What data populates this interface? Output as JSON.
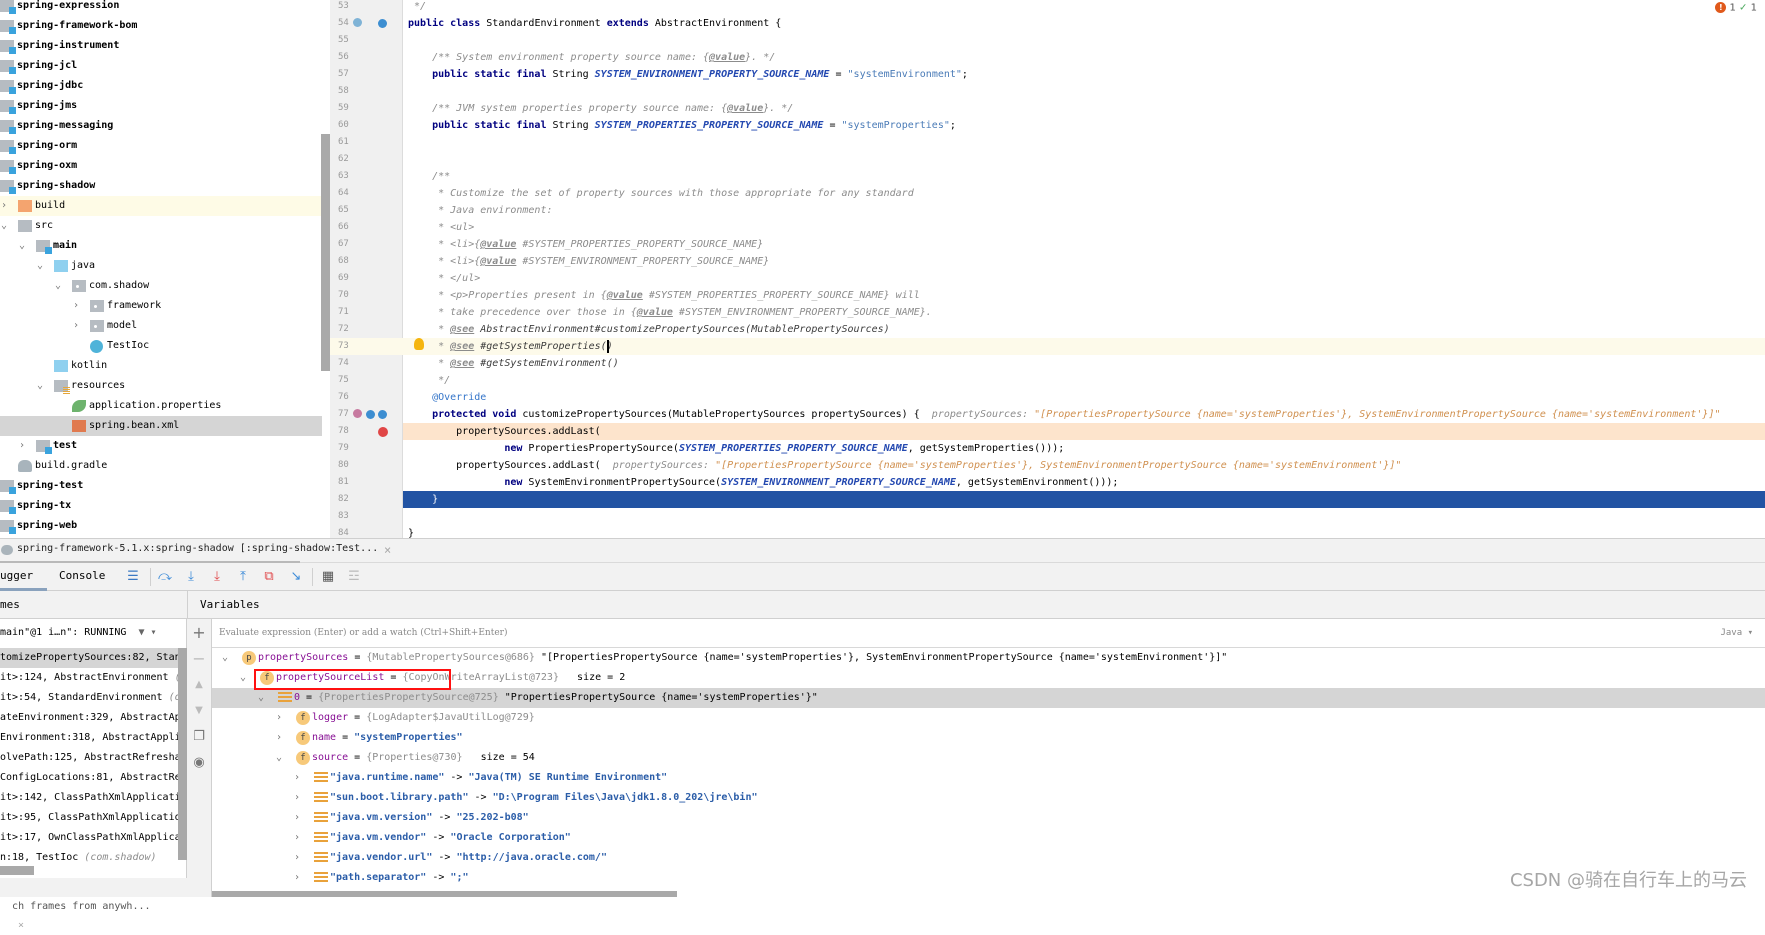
{
  "project_tree": [
    {
      "label": "spring-expression",
      "level": 0,
      "icon": "module-folder-icon",
      "bold": true
    },
    {
      "label": "spring-framework-bom",
      "level": 0,
      "icon": "module-folder-icon",
      "bold": true
    },
    {
      "label": "spring-instrument",
      "level": 0,
      "icon": "module-folder-icon",
      "bold": true
    },
    {
      "label": "spring-jcl",
      "level": 0,
      "icon": "module-folder-icon",
      "bold": true
    },
    {
      "label": "spring-jdbc",
      "level": 0,
      "icon": "module-folder-icon",
      "bold": true
    },
    {
      "label": "spring-jms",
      "level": 0,
      "icon": "module-folder-icon",
      "bold": true
    },
    {
      "label": "spring-messaging",
      "level": 0,
      "icon": "module-folder-icon",
      "bold": true
    },
    {
      "label": "spring-orm",
      "level": 0,
      "icon": "module-folder-icon",
      "bold": true
    },
    {
      "label": "spring-oxm",
      "level": 0,
      "icon": "module-folder-icon",
      "bold": true
    },
    {
      "label": "spring-shadow",
      "level": 0,
      "icon": "module-folder-icon",
      "bold": true
    },
    {
      "label": "build",
      "level": 1,
      "icon": "excluded-folder-icon",
      "chevron": "right",
      "highlight": "yellow"
    },
    {
      "label": "src",
      "level": 1,
      "icon": "folder-icon",
      "chevron": "down"
    },
    {
      "label": "main",
      "level": 2,
      "icon": "module-folder-icon",
      "chevron": "down",
      "bold": true
    },
    {
      "label": "java",
      "level": 3,
      "icon": "source-folder-icon",
      "chevron": "down"
    },
    {
      "label": "com.shadow",
      "level": 4,
      "icon": "package-icon",
      "chevron": "down"
    },
    {
      "label": "framework",
      "level": 5,
      "icon": "package-icon",
      "chevron": "right"
    },
    {
      "label": "model",
      "level": 5,
      "icon": "package-icon",
      "chevron": "right"
    },
    {
      "label": "TestIoc",
      "level": 5,
      "icon": "class-icon"
    },
    {
      "label": "kotlin",
      "level": 3,
      "icon": "source-folder-icon"
    },
    {
      "label": "resources",
      "level": 3,
      "icon": "resources-folder-icon",
      "chevron": "down"
    },
    {
      "label": "application.properties",
      "level": 4,
      "icon": "spring-properties-icon"
    },
    {
      "label": "spring.bean.xml",
      "level": 4,
      "icon": "spring-xml-icon",
      "highlight": "gray"
    },
    {
      "label": "test",
      "level": 2,
      "icon": "module-folder-icon",
      "chevron": "right",
      "bold": true
    },
    {
      "label": "build.gradle",
      "level": 1,
      "icon": "gradle-icon"
    },
    {
      "label": "spring-test",
      "level": 0,
      "icon": "module-folder-icon",
      "bold": true
    },
    {
      "label": "spring-tx",
      "level": 0,
      "icon": "module-folder-icon",
      "bold": true
    },
    {
      "label": "spring-web",
      "level": 0,
      "icon": "module-folder-icon",
      "bold": true
    }
  ],
  "editor": {
    "inspection": {
      "errors": "1",
      "ok": "1"
    },
    "lines": [
      {
        "n": "53",
        "t": [
          [
            " */",
            "cm"
          ]
        ]
      },
      {
        "n": "54",
        "t": [
          [
            "public class ",
            "kw"
          ],
          [
            "StandardEnvironment ",
            "pl"
          ],
          [
            "extends ",
            "kw"
          ],
          [
            "AbstractEnvironment {",
            "pl"
          ]
        ]
      },
      {
        "n": "55",
        "t": []
      },
      {
        "n": "56",
        "t": [
          [
            "    /** System environment property source name: {",
            "cm"
          ],
          [
            "@value",
            "tag"
          ],
          [
            "}. */",
            "cm"
          ]
        ]
      },
      {
        "n": "57",
        "t": [
          [
            "    public static final ",
            "kw"
          ],
          [
            "String ",
            "pl"
          ],
          [
            "SYSTEM_ENVIRONMENT_PROPERTY_SOURCE_NAME",
            "cst"
          ],
          [
            " = ",
            "pl"
          ],
          [
            "\"systemEnvironment\"",
            "str"
          ],
          [
            ";",
            "pl"
          ]
        ]
      },
      {
        "n": "58",
        "t": []
      },
      {
        "n": "59",
        "t": [
          [
            "    /** JVM system properties property source name: {",
            "cm"
          ],
          [
            "@value",
            "tag"
          ],
          [
            "}. */",
            "cm"
          ]
        ]
      },
      {
        "n": "60",
        "t": [
          [
            "    public static final ",
            "kw"
          ],
          [
            "String ",
            "pl"
          ],
          [
            "SYSTEM_PROPERTIES_PROPERTY_SOURCE_NAME",
            "cst"
          ],
          [
            " = ",
            "pl"
          ],
          [
            "\"systemProperties\"",
            "str"
          ],
          [
            ";",
            "pl"
          ]
        ]
      },
      {
        "n": "61",
        "t": []
      },
      {
        "n": "62",
        "t": []
      },
      {
        "n": "63",
        "t": [
          [
            "    /**",
            "cm"
          ]
        ]
      },
      {
        "n": "64",
        "t": [
          [
            "     * Customize the set of property sources with those appropriate for any standard",
            "cm"
          ]
        ]
      },
      {
        "n": "65",
        "t": [
          [
            "     * Java environment:",
            "cm"
          ]
        ]
      },
      {
        "n": "66",
        "t": [
          [
            "     * <ul>",
            "cm"
          ]
        ]
      },
      {
        "n": "67",
        "t": [
          [
            "     * <li>{",
            "cm"
          ],
          [
            "@value",
            "tag"
          ],
          [
            " #SYSTEM_PROPERTIES_PROPERTY_SOURCE_NAME}",
            "cm"
          ]
        ]
      },
      {
        "n": "68",
        "t": [
          [
            "     * <li>{",
            "cm"
          ],
          [
            "@value",
            "tag"
          ],
          [
            " #SYSTEM_ENVIRONMENT_PROPERTY_SOURCE_NAME}",
            "cm"
          ]
        ]
      },
      {
        "n": "69",
        "t": [
          [
            "     * </ul>",
            "cm"
          ]
        ]
      },
      {
        "n": "70",
        "t": [
          [
            "     * <p>Properties present in {",
            "cm"
          ],
          [
            "@value",
            "tag"
          ],
          [
            " #SYSTEM_PROPERTIES_PROPERTY_SOURCE_NAME} will",
            "cm"
          ]
        ]
      },
      {
        "n": "71",
        "t": [
          [
            "     * take precedence over those in {",
            "cm"
          ],
          [
            "@value",
            "tag"
          ],
          [
            " #SYSTEM_ENVIRONMENT_PROPERTY_SOURCE_NAME}.",
            "cm"
          ]
        ]
      },
      {
        "n": "72",
        "t": [
          [
            "     * ",
            "cm"
          ],
          [
            "@see",
            "tag"
          ],
          [
            " AbstractEnvironment#customizePropertySources(MutablePropertySources)",
            "doc"
          ]
        ]
      },
      {
        "n": "73",
        "t": [
          [
            "     * ",
            "cm"
          ],
          [
            "@see",
            "tag"
          ],
          [
            " #getSystemProperties()",
            "doc"
          ]
        ],
        "bg": "y"
      },
      {
        "n": "74",
        "t": [
          [
            "     * ",
            "cm"
          ],
          [
            "@see",
            "tag"
          ],
          [
            " #getSystemEnvironment()",
            "doc"
          ]
        ]
      },
      {
        "n": "75",
        "t": [
          [
            "     */",
            "cm"
          ]
        ]
      },
      {
        "n": "76",
        "t": [
          [
            "    @Override",
            "ann"
          ]
        ]
      },
      {
        "n": "77",
        "t": [
          [
            "    protected void ",
            "kw"
          ],
          [
            "customizePropertySources(MutablePropertySources propertySources) {  ",
            "pl"
          ],
          [
            "propertySources: ",
            "dbgn"
          ],
          [
            "\"[PropertiesPropertySource {name='systemProperties'}, SystemEnvironmentPropertySource {name='systemEnvironment'}]\"",
            "dbg"
          ]
        ]
      },
      {
        "n": "78",
        "t": [
          [
            "        propertySources.addLast(",
            "pl"
          ]
        ],
        "bg": "o"
      },
      {
        "n": "79",
        "t": [
          [
            "                new ",
            "kw"
          ],
          [
            "PropertiesPropertySource(",
            "pl"
          ],
          [
            "SYSTEM_PROPERTIES_PROPERTY_SOURCE_NAME",
            "cst"
          ],
          [
            ", getSystemProperties()));",
            "pl"
          ]
        ]
      },
      {
        "n": "80",
        "t": [
          [
            "        propertySources.addLast(  ",
            "pl"
          ],
          [
            "propertySources: ",
            "dbgn"
          ],
          [
            "\"[PropertiesPropertySource {name='systemProperties'}, SystemEnvironmentPropertySource {name='systemEnvironment'}]\"",
            "dbg"
          ]
        ]
      },
      {
        "n": "81",
        "t": [
          [
            "                new ",
            "kw"
          ],
          [
            "SystemEnvironmentPropertySource(",
            "pl"
          ],
          [
            "SYSTEM_ENVIRONMENT_PROPERTY_SOURCE_NAME",
            "cst"
          ],
          [
            ", getSystemEnvironment()));",
            "pl"
          ]
        ]
      },
      {
        "n": "82",
        "t": [
          [
            "    }",
            "pl"
          ]
        ],
        "bg": "b"
      },
      {
        "n": "83",
        "t": []
      },
      {
        "n": "84",
        "t": [
          [
            "}",
            "pl"
          ]
        ]
      }
    ]
  },
  "debug": {
    "session_title": "spring-framework-5.1.x:spring-shadow [:spring-shadow:Test...",
    "tabs": [
      {
        "label": "ugger",
        "selected": true
      },
      {
        "label": "Console",
        "selected": false
      }
    ],
    "toolbar": [
      "show-execution-point-icon",
      "step-over-icon",
      "step-into-icon",
      "force-step-into-icon",
      "step-out-icon",
      "drop-frame-icon",
      "run-to-cursor-icon",
      "evaluate-expression-icon",
      "trace-icon"
    ],
    "frames_header": "mes",
    "variables_header": "Variables",
    "thread": "main\"@1 i…n\": RUNNING",
    "frames": [
      {
        "text": "tomizePropertySources:82, Stand",
        "pkg": ""
      },
      {
        "text": "it>:124, AbstractEnvironment ",
        "pkg": "(o"
      },
      {
        "text": "it>:54, StandardEnvironment ",
        "pkg": "(or"
      },
      {
        "text": "ateEnvironment:329, AbstractApp",
        "pkg": ""
      },
      {
        "text": "Environment:318, AbstractApplic",
        "pkg": ""
      },
      {
        "text": "olvePath:125, AbstractRefreshab",
        "pkg": ""
      },
      {
        "text": "ConfigLocations:81, AbstractRef",
        "pkg": ""
      },
      {
        "text": "it>:142, ClassPathXmlApplicatio",
        "pkg": ""
      },
      {
        "text": "it>:95, ClassPathXmlApplication",
        "pkg": ""
      },
      {
        "text": "it>:17, OwnClassPathXmlApplicat",
        "pkg": ""
      },
      {
        "text": "n:18, TestIoc ",
        "pkg": "(com.shadow)"
      }
    ],
    "frames_search": "ch frames from anywh...",
    "evaluate_placeholder": "Evaluate expression (Enter) or add a watch (Ctrl+Shift+Enter)",
    "language": "Java",
    "variables": [
      {
        "level": 0,
        "chevron": "down",
        "icon": "p",
        "name": "propertySources",
        "type": "{MutablePropertySources@686}",
        "value": "\"[PropertiesPropertySource {name='systemProperties'}, SystemEnvironmentPropertySource {name='systemEnvironment'}]\"",
        "vclass": "vp"
      },
      {
        "level": 1,
        "chevron": "down",
        "icon": "f",
        "name": "propertySourceList",
        "type": "{CopyOnWriteArrayList@723}",
        "value": "  size = 2",
        "vclass": "vp",
        "boxed": true
      },
      {
        "level": 2,
        "chevron": "down",
        "icon": "list",
        "name": "0",
        "type": "{PropertiesPropertySource@725}",
        "value": "\"PropertiesPropertySource {name='systemProperties'}\"",
        "vclass": "vp",
        "selected": true
      },
      {
        "level": 3,
        "chevron": "right",
        "icon": "f",
        "name": "logger",
        "type": "{LogAdapter$JavaUtilLog@729}",
        "value": "",
        "vclass": "vp"
      },
      {
        "level": 3,
        "chevron": "right",
        "icon": "f",
        "name": "name",
        "type": "",
        "value": "\"systemProperties\"",
        "vclass": "vs"
      },
      {
        "level": 3,
        "chevron": "down",
        "icon": "f",
        "name": "source",
        "type": "{Properties@730}",
        "value": "  size = 54",
        "vclass": "vp"
      },
      {
        "level": 4,
        "chevron": "right",
        "icon": "entry",
        "name": "\"java.runtime.name\"",
        "arrow": true,
        "value": "\"Java(TM) SE Runtime Environment\"",
        "vclass": "vs"
      },
      {
        "level": 4,
        "chevron": "right",
        "icon": "entry",
        "name": "\"sun.boot.library.path\"",
        "arrow": true,
        "value": "\"D:\\Program Files\\Java\\jdk1.8.0_202\\jre\\bin\"",
        "vclass": "vs"
      },
      {
        "level": 4,
        "chevron": "right",
        "icon": "entry",
        "name": "\"java.vm.version\"",
        "arrow": true,
        "value": "\"25.202-b08\"",
        "vclass": "vs"
      },
      {
        "level": 4,
        "chevron": "right",
        "icon": "entry",
        "name": "\"java.vm.vendor\"",
        "arrow": true,
        "value": "\"Oracle Corporation\"",
        "vclass": "vs"
      },
      {
        "level": 4,
        "chevron": "right",
        "icon": "entry",
        "name": "\"java.vendor.url\"",
        "arrow": true,
        "value": "\"http://java.oracle.com/\"",
        "vclass": "vs"
      },
      {
        "level": 4,
        "chevron": "right",
        "icon": "entry",
        "name": "\"path.separator\"",
        "arrow": true,
        "value": "\";\"",
        "vclass": "vs"
      }
    ]
  },
  "watermark": "CSDN @骑在自行车上的马云",
  "colors": {
    "execution_line": "#2253a3",
    "breakpoint_line": "#fde4cc",
    "annotation_box": "#ff1010"
  }
}
